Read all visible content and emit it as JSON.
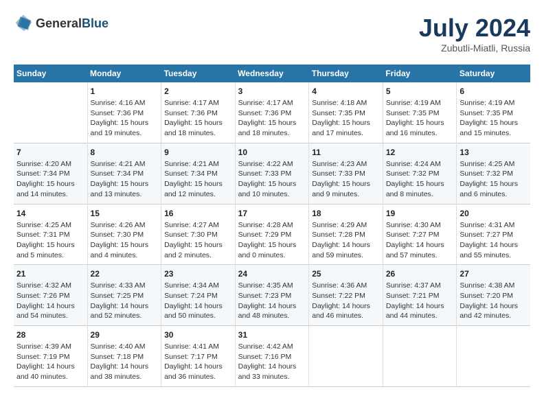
{
  "header": {
    "logo_general": "General",
    "logo_blue": "Blue",
    "month_year": "July 2024",
    "location": "Zubutli-Miatli, Russia"
  },
  "days_of_week": [
    "Sunday",
    "Monday",
    "Tuesday",
    "Wednesday",
    "Thursday",
    "Friday",
    "Saturday"
  ],
  "weeks": [
    [
      {
        "day": "",
        "details": ""
      },
      {
        "day": "1",
        "details": "Sunrise: 4:16 AM\nSunset: 7:36 PM\nDaylight: 15 hours\nand 19 minutes."
      },
      {
        "day": "2",
        "details": "Sunrise: 4:17 AM\nSunset: 7:36 PM\nDaylight: 15 hours\nand 18 minutes."
      },
      {
        "day": "3",
        "details": "Sunrise: 4:17 AM\nSunset: 7:36 PM\nDaylight: 15 hours\nand 18 minutes."
      },
      {
        "day": "4",
        "details": "Sunrise: 4:18 AM\nSunset: 7:35 PM\nDaylight: 15 hours\nand 17 minutes."
      },
      {
        "day": "5",
        "details": "Sunrise: 4:19 AM\nSunset: 7:35 PM\nDaylight: 15 hours\nand 16 minutes."
      },
      {
        "day": "6",
        "details": "Sunrise: 4:19 AM\nSunset: 7:35 PM\nDaylight: 15 hours\nand 15 minutes."
      }
    ],
    [
      {
        "day": "7",
        "details": "Sunrise: 4:20 AM\nSunset: 7:34 PM\nDaylight: 15 hours\nand 14 minutes."
      },
      {
        "day": "8",
        "details": "Sunrise: 4:21 AM\nSunset: 7:34 PM\nDaylight: 15 hours\nand 13 minutes."
      },
      {
        "day": "9",
        "details": "Sunrise: 4:21 AM\nSunset: 7:34 PM\nDaylight: 15 hours\nand 12 minutes."
      },
      {
        "day": "10",
        "details": "Sunrise: 4:22 AM\nSunset: 7:33 PM\nDaylight: 15 hours\nand 10 minutes."
      },
      {
        "day": "11",
        "details": "Sunrise: 4:23 AM\nSunset: 7:33 PM\nDaylight: 15 hours\nand 9 minutes."
      },
      {
        "day": "12",
        "details": "Sunrise: 4:24 AM\nSunset: 7:32 PM\nDaylight: 15 hours\nand 8 minutes."
      },
      {
        "day": "13",
        "details": "Sunrise: 4:25 AM\nSunset: 7:32 PM\nDaylight: 15 hours\nand 6 minutes."
      }
    ],
    [
      {
        "day": "14",
        "details": "Sunrise: 4:25 AM\nSunset: 7:31 PM\nDaylight: 15 hours\nand 5 minutes."
      },
      {
        "day": "15",
        "details": "Sunrise: 4:26 AM\nSunset: 7:30 PM\nDaylight: 15 hours\nand 4 minutes."
      },
      {
        "day": "16",
        "details": "Sunrise: 4:27 AM\nSunset: 7:30 PM\nDaylight: 15 hours\nand 2 minutes."
      },
      {
        "day": "17",
        "details": "Sunrise: 4:28 AM\nSunset: 7:29 PM\nDaylight: 15 hours\nand 0 minutes."
      },
      {
        "day": "18",
        "details": "Sunrise: 4:29 AM\nSunset: 7:28 PM\nDaylight: 14 hours\nand 59 minutes."
      },
      {
        "day": "19",
        "details": "Sunrise: 4:30 AM\nSunset: 7:27 PM\nDaylight: 14 hours\nand 57 minutes."
      },
      {
        "day": "20",
        "details": "Sunrise: 4:31 AM\nSunset: 7:27 PM\nDaylight: 14 hours\nand 55 minutes."
      }
    ],
    [
      {
        "day": "21",
        "details": "Sunrise: 4:32 AM\nSunset: 7:26 PM\nDaylight: 14 hours\nand 54 minutes."
      },
      {
        "day": "22",
        "details": "Sunrise: 4:33 AM\nSunset: 7:25 PM\nDaylight: 14 hours\nand 52 minutes."
      },
      {
        "day": "23",
        "details": "Sunrise: 4:34 AM\nSunset: 7:24 PM\nDaylight: 14 hours\nand 50 minutes."
      },
      {
        "day": "24",
        "details": "Sunrise: 4:35 AM\nSunset: 7:23 PM\nDaylight: 14 hours\nand 48 minutes."
      },
      {
        "day": "25",
        "details": "Sunrise: 4:36 AM\nSunset: 7:22 PM\nDaylight: 14 hours\nand 46 minutes."
      },
      {
        "day": "26",
        "details": "Sunrise: 4:37 AM\nSunset: 7:21 PM\nDaylight: 14 hours\nand 44 minutes."
      },
      {
        "day": "27",
        "details": "Sunrise: 4:38 AM\nSunset: 7:20 PM\nDaylight: 14 hours\nand 42 minutes."
      }
    ],
    [
      {
        "day": "28",
        "details": "Sunrise: 4:39 AM\nSunset: 7:19 PM\nDaylight: 14 hours\nand 40 minutes."
      },
      {
        "day": "29",
        "details": "Sunrise: 4:40 AM\nSunset: 7:18 PM\nDaylight: 14 hours\nand 38 minutes."
      },
      {
        "day": "30",
        "details": "Sunrise: 4:41 AM\nSunset: 7:17 PM\nDaylight: 14 hours\nand 36 minutes."
      },
      {
        "day": "31",
        "details": "Sunrise: 4:42 AM\nSunset: 7:16 PM\nDaylight: 14 hours\nand 33 minutes."
      },
      {
        "day": "",
        "details": ""
      },
      {
        "day": "",
        "details": ""
      },
      {
        "day": "",
        "details": ""
      }
    ]
  ]
}
